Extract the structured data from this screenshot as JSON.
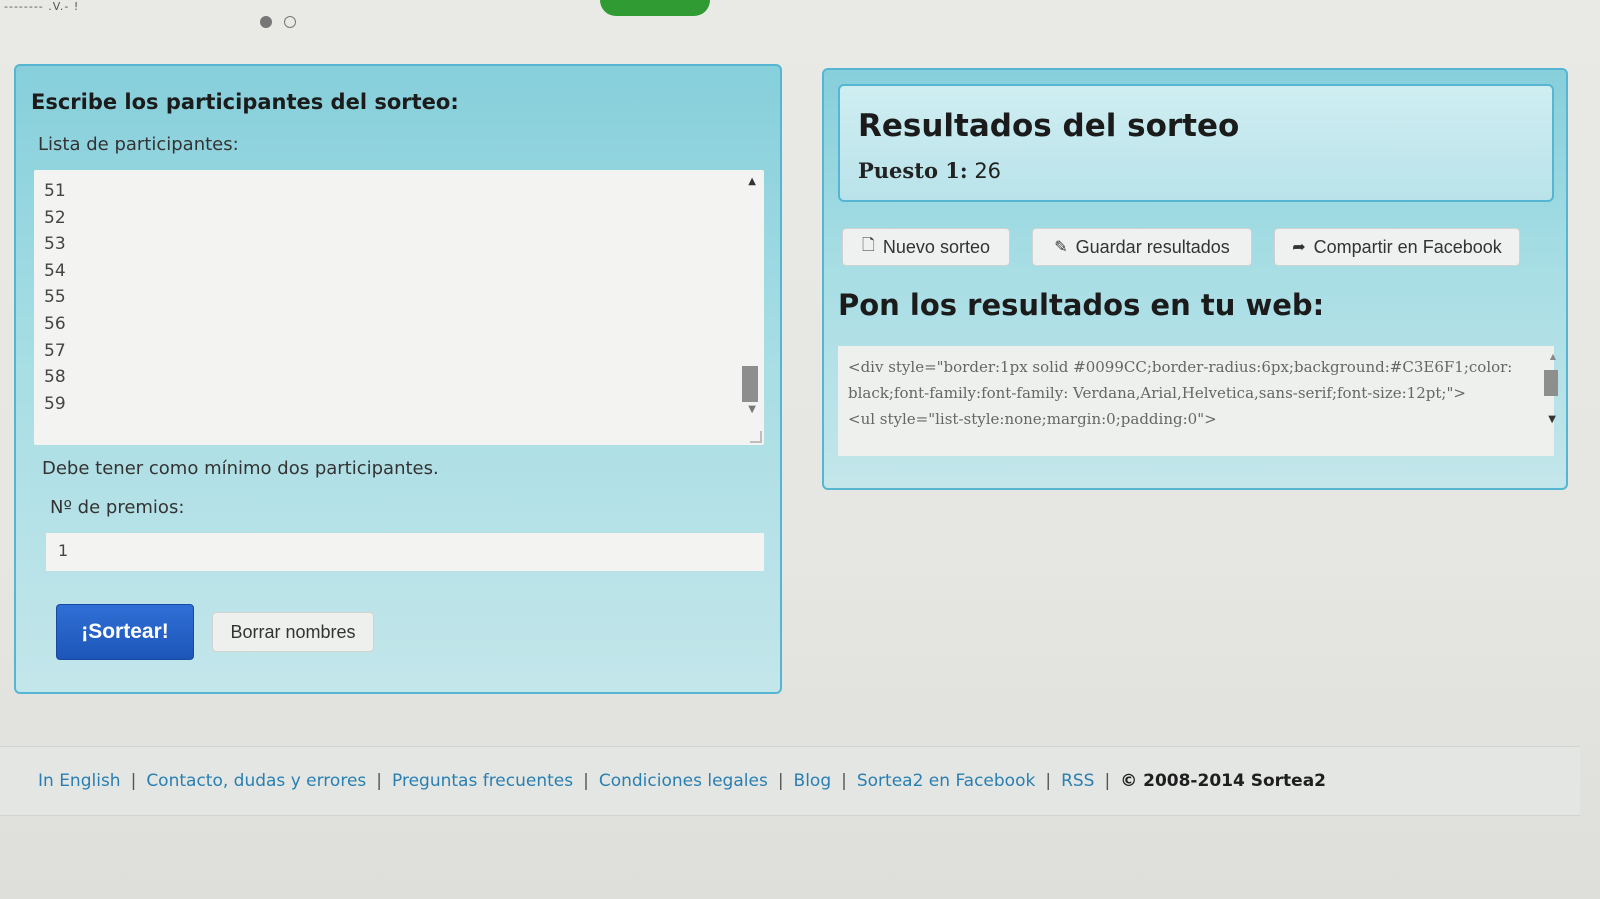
{
  "top": {
    "scribble": "-------- .V.- !"
  },
  "left_panel": {
    "title": "Escribe los participantes del sorteo:",
    "list_label": "Lista de participantes:",
    "participants": [
      "51",
      "52",
      "53",
      "54",
      "55",
      "56",
      "57",
      "58",
      "59"
    ],
    "min_message": "Debe tener como mínimo dos participantes.",
    "prizes_label": "Nº de premios:",
    "prizes_value": "1",
    "draw_button": "¡Sortear!",
    "clear_button": "Borrar nombres"
  },
  "right_panel": {
    "results_title": "Resultados del sorteo",
    "place_label": "Puesto 1:",
    "place_value": "26",
    "new_draw_button": "Nuevo sorteo",
    "save_button": "Guardar resultados",
    "share_button": "Compartir en Facebook",
    "embed_title": "Pon los resultados en tu web:",
    "embed_code": "<div style=\"border:1px solid #0099CC;border-radius:6px;background:#C3E6F1;color:black;font-family:font-family: Verdana,Arial,Helvetica,sans-serif;font-size:12pt;\">\n<ul style=\"list-style:none;margin:0;padding:0\">"
  },
  "footer": {
    "links": [
      "In English",
      "Contacto, dudas y errores",
      "Preguntas frecuentes",
      "Condiciones legales",
      "Blog",
      "Sortea2 en Facebook",
      "RSS"
    ],
    "copyright": "© 2008-2014 Sortea2"
  },
  "colors": {
    "panel_border": "#56b6d2",
    "panel_bg": "#a6dde4",
    "primary_button": "#1d56b8",
    "link": "#2a7fb2"
  }
}
